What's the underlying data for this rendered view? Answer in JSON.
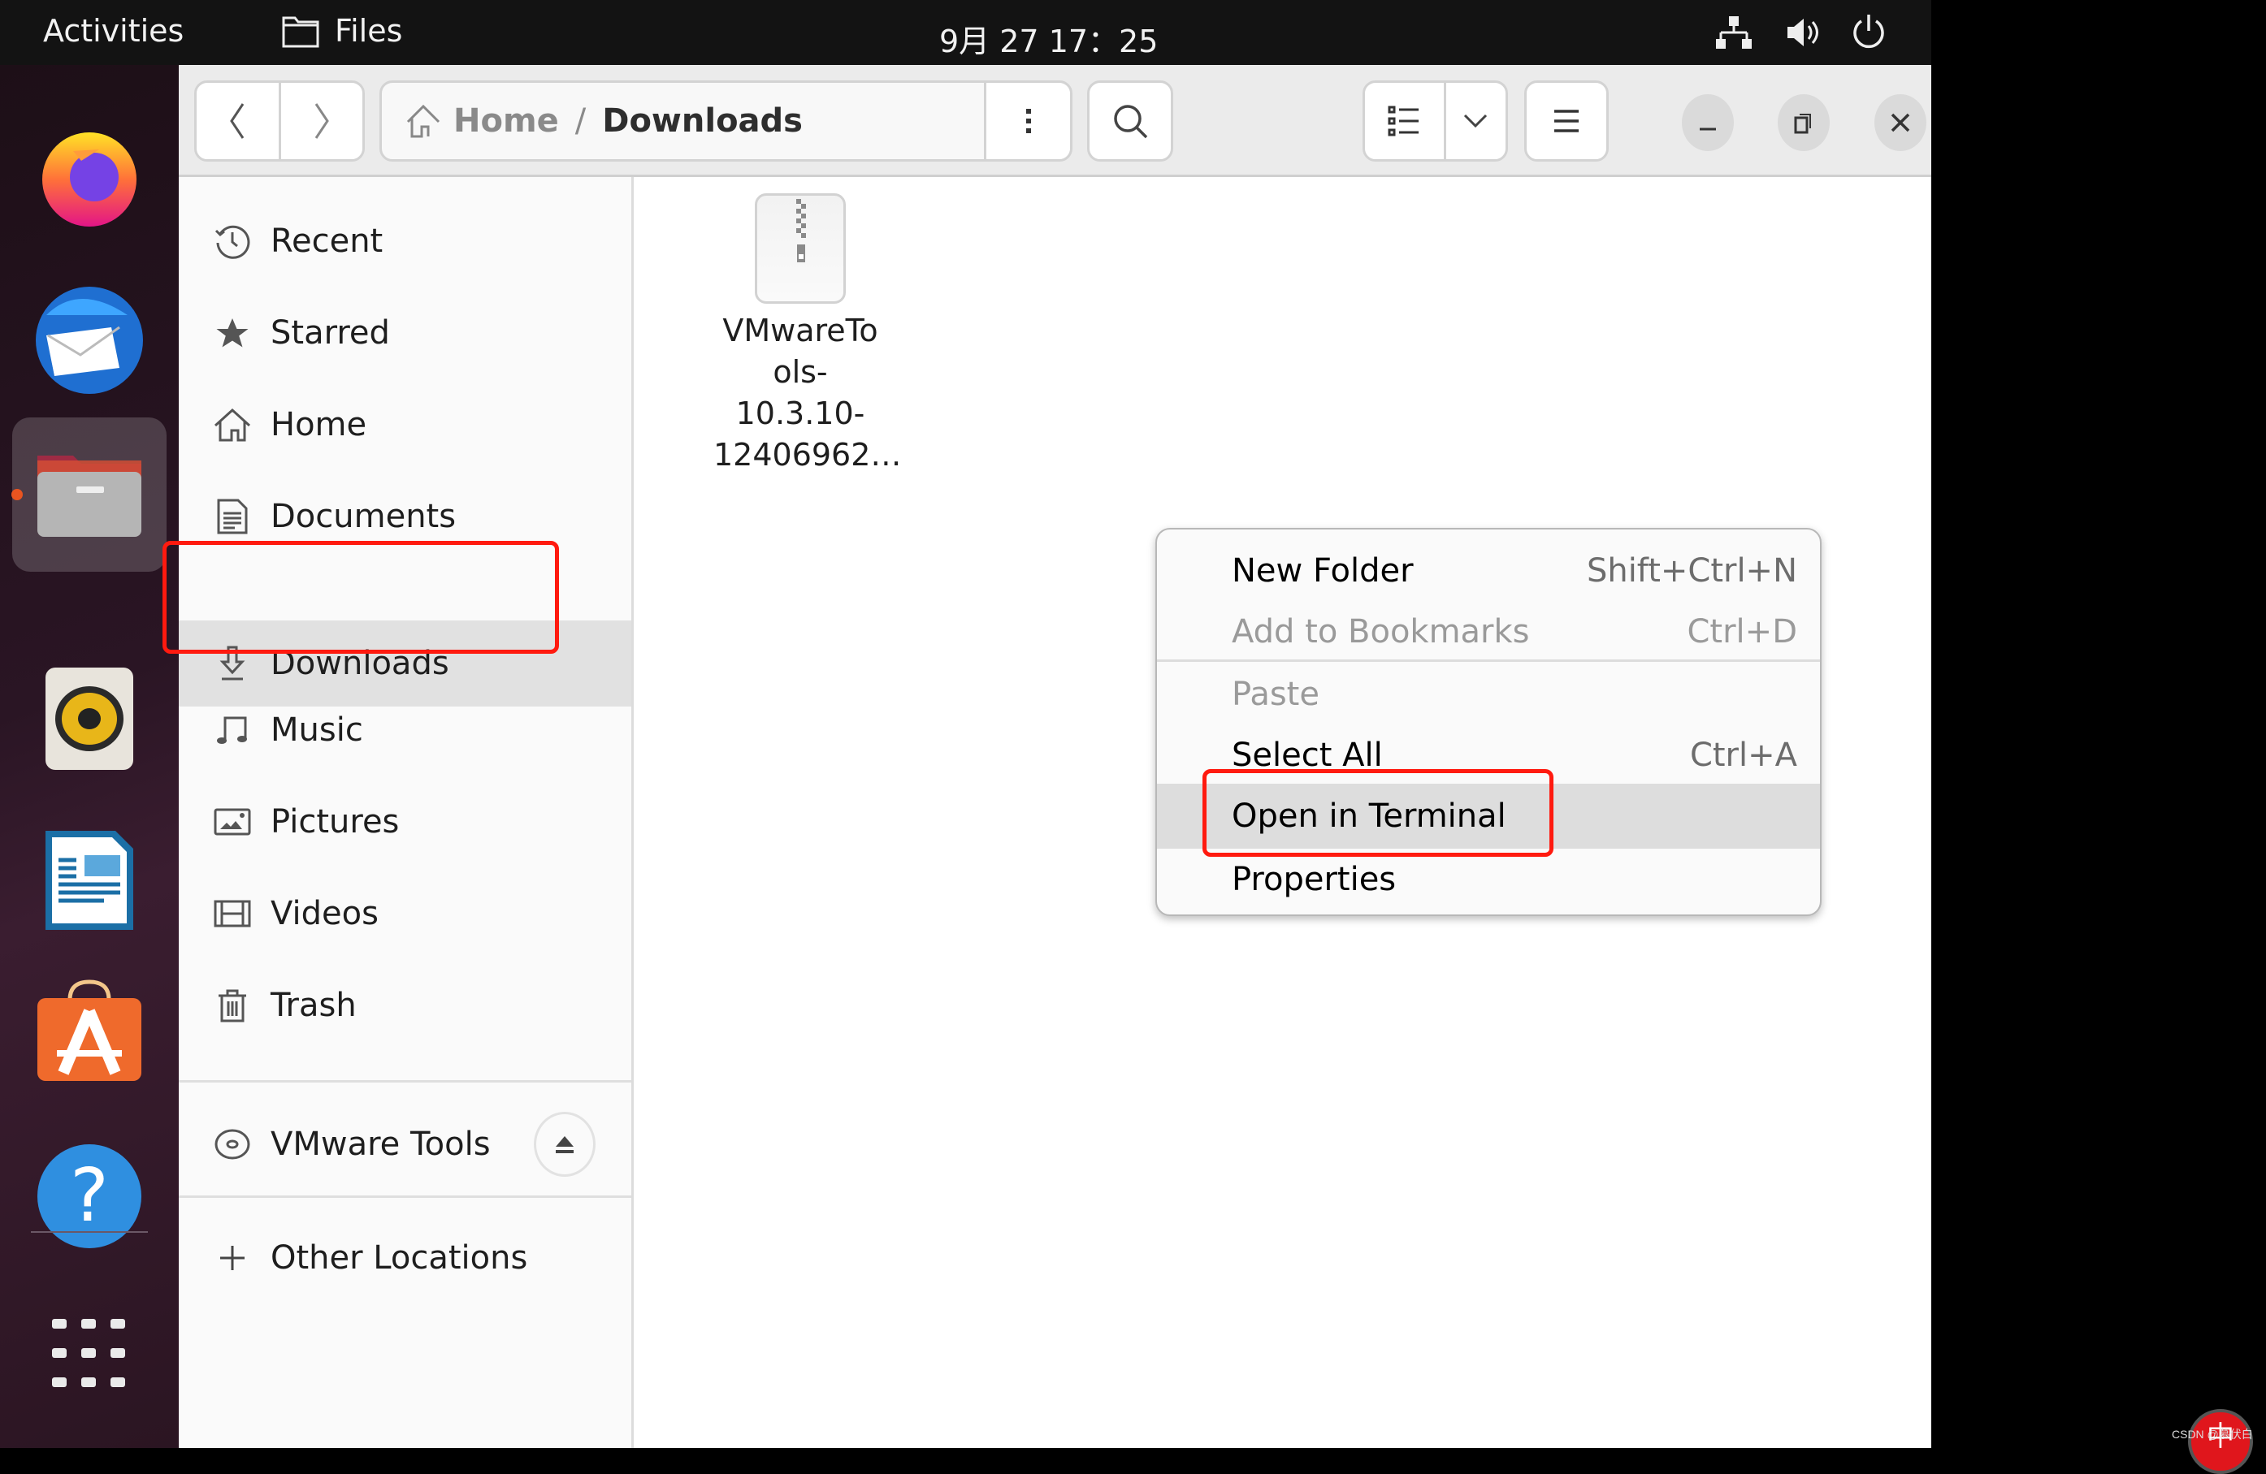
{
  "topbar": {
    "activities": "Activities",
    "app_name": "Files",
    "clock": "9月 27  17：25",
    "tray_icons": [
      "network-icon",
      "volume-icon",
      "power-icon"
    ]
  },
  "dock": {
    "apps": [
      {
        "name": "Firefox",
        "icon": "firefox-icon"
      },
      {
        "name": "Thunderbird",
        "icon": "thunderbird-icon"
      },
      {
        "name": "Files",
        "icon": "files-icon",
        "running": true
      },
      {
        "name": "Rhythmbox",
        "icon": "rhythmbox-icon"
      },
      {
        "name": "LibreOffice Writer",
        "icon": "writer-icon"
      },
      {
        "name": "Ubuntu Software",
        "icon": "software-icon"
      },
      {
        "name": "Help",
        "icon": "help-icon"
      }
    ],
    "show_apps_icon": "app-grid-icon"
  },
  "header": {
    "breadcrumb": [
      {
        "label": "Home",
        "icon": "home-icon"
      },
      {
        "label": "/"
      },
      {
        "label": "Downloads"
      }
    ]
  },
  "sidebar": {
    "places": [
      {
        "label": "Recent",
        "icon": "clock-icon"
      },
      {
        "label": "Starred",
        "icon": "star-icon"
      },
      {
        "label": "Home",
        "icon": "home-icon"
      },
      {
        "label": "Documents",
        "icon": "document-icon"
      },
      {
        "label": "Downloads",
        "icon": "download-icon",
        "selected": true
      },
      {
        "label": "Music",
        "icon": "music-icon"
      },
      {
        "label": "Pictures",
        "icon": "pictures-icon"
      },
      {
        "label": "Videos",
        "icon": "video-icon"
      },
      {
        "label": "Trash",
        "icon": "trash-icon"
      }
    ],
    "devices": [
      {
        "label": "VMware Tools",
        "icon": "disc-icon",
        "action_icon": "eject-icon"
      }
    ],
    "other": {
      "label": "Other Locations",
      "icon": "plus-icon"
    }
  },
  "files": [
    {
      "name_lines": [
        "VMwareTo",
        "ols-10.3.10-",
        "12406962…"
      ],
      "icon": "archive-icon"
    }
  ],
  "context_menu": {
    "items": [
      {
        "label": "New Folder",
        "shortcut": "Shift+Ctrl+N",
        "disabled": false
      },
      {
        "label": "Add to Bookmarks",
        "shortcut": "Ctrl+D",
        "disabled": true
      },
      {
        "separator": true
      },
      {
        "label": "Paste",
        "shortcut": "",
        "disabled": true
      },
      {
        "label": "Select All",
        "shortcut": "Ctrl+A",
        "disabled": false
      },
      {
        "label": "Open in Terminal",
        "shortcut": "",
        "disabled": false,
        "highlighted": true
      },
      {
        "label": "Properties",
        "shortcut": "",
        "disabled": false
      }
    ]
  },
  "annotation_color": "#ff1a0f",
  "watermark": "CSDN @慕伏白",
  "ime_indicator": "中"
}
